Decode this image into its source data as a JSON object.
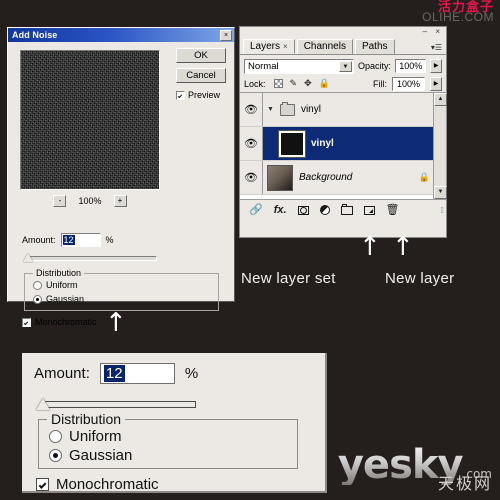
{
  "dialog": {
    "title": "Add Noise",
    "close_label": "×",
    "ok_label": "OK",
    "cancel_label": "Cancel",
    "preview_label": "Preview",
    "preview_checked": true,
    "zoom_out_label": "-",
    "zoom_in_label": "+",
    "zoom_level": "100%",
    "amount_label": "Amount:",
    "amount_value": "12",
    "percent_label": "%",
    "distribution_label": "Distribution",
    "uniform_label": "Uniform",
    "gaussian_label": "Gaussian",
    "selected_distribution": "Gaussian",
    "monochromatic_label": "Monochromatic",
    "monochromatic_checked": true
  },
  "layers_panel": {
    "minimize_label": "–",
    "close_label": "×",
    "menu_label": "▾☰",
    "tabs": [
      {
        "label": "Layers",
        "close": "×",
        "active": true
      },
      {
        "label": "Channels",
        "active": false
      },
      {
        "label": "Paths",
        "active": false
      }
    ],
    "blend_mode": "Normal",
    "blend_arrow": "▼",
    "opacity_label": "Opacity:",
    "opacity_value": "100%",
    "opacity_arrow": "▶",
    "lock_label": "Lock:",
    "lock_icons": [
      "transparency-checker",
      "brush",
      "move",
      "lock"
    ],
    "fill_label": "Fill:",
    "fill_value": "100%",
    "fill_arrow": "▶",
    "eye_glyph": "👁",
    "layers": [
      {
        "name": "vinyl",
        "type": "group",
        "visible": true,
        "expanded": true,
        "selected": false,
        "locked": false
      },
      {
        "name": "vinyl",
        "type": "layer",
        "visible": true,
        "selected": true,
        "locked": false
      },
      {
        "name": "Background",
        "type": "background",
        "visible": true,
        "selected": false,
        "locked": true,
        "lock_glyph": "🔒"
      }
    ],
    "scroll_up": "▲",
    "scroll_down": "▼",
    "footer_buttons": [
      {
        "name": "link-layers",
        "label": "🔗"
      },
      {
        "name": "layer-style-fx",
        "label": "fx."
      },
      {
        "name": "add-layer-mask",
        "label": ""
      },
      {
        "name": "new-adjustment-layer",
        "label": ""
      },
      {
        "name": "new-layer-set",
        "label": ""
      },
      {
        "name": "new-layer",
        "label": ""
      },
      {
        "name": "delete-layer",
        "label": "🗑"
      }
    ]
  },
  "annotations": {
    "arrow_glyph": "↑",
    "new_layer_set": "New layer set",
    "new_layer": "New layer"
  },
  "zoom_panel": {
    "amount_label": "Amount:",
    "amount_value": "12",
    "percent_label": "%",
    "distribution_label": "Distribution",
    "uniform_label": "Uniform",
    "gaussian_label": "Gaussian",
    "selected_distribution": "Gaussian",
    "monochromatic_label": "Monochromatic",
    "monochromatic_checked": true
  },
  "watermarks": {
    "top_cn": "活力盒子",
    "top_en": "OLIHE.COM",
    "bottom_brand": "yesky",
    "bottom_tld": ".com",
    "bottom_cn": "天极网"
  },
  "colors": {
    "titlebar_start": "#12369e",
    "selection": "#0c2a75",
    "field_selection": "#0a246a",
    "chrome": "#ece9e4",
    "backdrop": "#241f1d",
    "watermark_red": "#e8134a"
  }
}
